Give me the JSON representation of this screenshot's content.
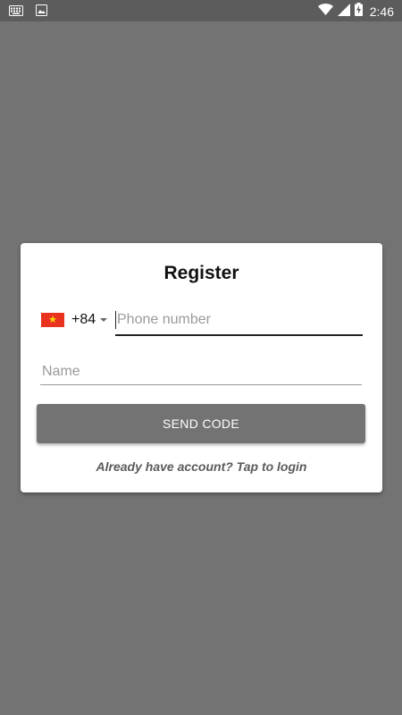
{
  "status_bar": {
    "time": "2:46",
    "icons": [
      "keyboard-icon",
      "image-icon",
      "wifi-icon",
      "signal-icon",
      "battery-charging-icon"
    ]
  },
  "register": {
    "title": "Register",
    "country": {
      "flag": "vietnam-flag-icon",
      "dial_code": "+84"
    },
    "phone_placeholder": "Phone number",
    "name_placeholder": "Name",
    "send_button_label": "SEND CODE",
    "login_link": "Already have account? Tap to login"
  },
  "colors": {
    "overlay_background": "#737373",
    "status_bar": "#5c5c5c",
    "card": "#ffffff",
    "button": "#737373",
    "flag_red": "#e9331f",
    "flag_star": "#f5d90a"
  }
}
